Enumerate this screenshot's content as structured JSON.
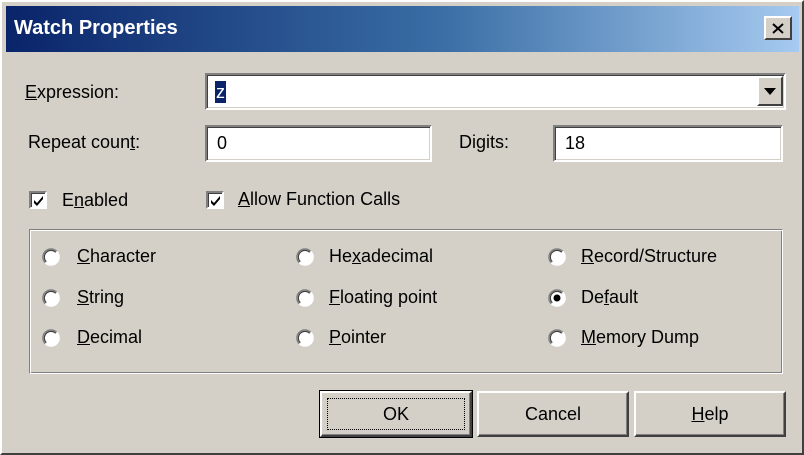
{
  "window": {
    "title": "Watch Properties"
  },
  "expression": {
    "label": "Expression:",
    "value": "z"
  },
  "repeat_count": {
    "label": "Repeat count:",
    "value": "0"
  },
  "digits": {
    "label": "Digits:",
    "value": "18"
  },
  "enabled": {
    "label": "Enabled",
    "checked": true
  },
  "allow_function_calls": {
    "label": "Allow Function Calls",
    "checked": true
  },
  "format_options": [
    {
      "label": "Character",
      "selected": false
    },
    {
      "label": "Hexadecimal",
      "selected": false
    },
    {
      "label": "Record/Structure",
      "selected": false
    },
    {
      "label": "String",
      "selected": false
    },
    {
      "label": "Floating point",
      "selected": false
    },
    {
      "label": "Default",
      "selected": true
    },
    {
      "label": "Decimal",
      "selected": false
    },
    {
      "label": "Pointer",
      "selected": false
    },
    {
      "label": "Memory Dump",
      "selected": false
    }
  ],
  "buttons": {
    "ok": "OK",
    "cancel": "Cancel",
    "help": "Help"
  },
  "colors": {
    "face": "#d4d0c8",
    "title_start": "#0a246a",
    "title_end": "#a6caf0",
    "selection": "#0a246a"
  }
}
